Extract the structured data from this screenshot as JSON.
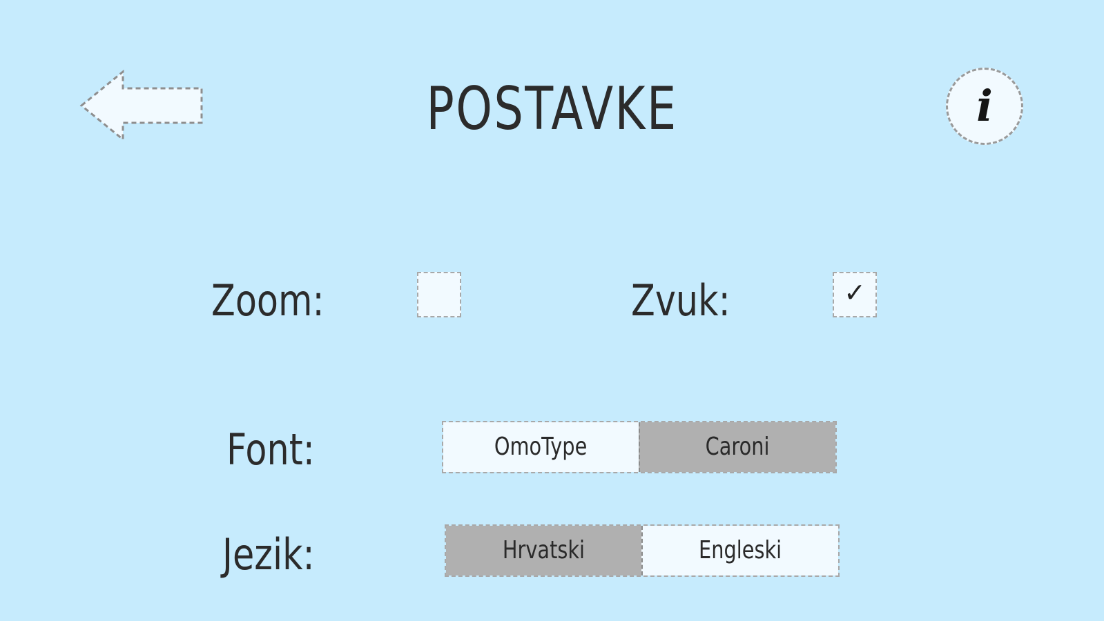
{
  "header": {
    "title": "POSTAVKE",
    "back_icon": "arrow-left-icon",
    "info_icon": "info-icon",
    "info_glyph": "i"
  },
  "settings": {
    "zoom": {
      "label": "Zoom:",
      "checked": false
    },
    "sound": {
      "label": "Zvuk:",
      "checked": true,
      "check_glyph": "✓"
    },
    "font": {
      "label": "Font:",
      "options": [
        "OmoType",
        "Caroni"
      ],
      "selected": "Caroni"
    },
    "language": {
      "label": "Jezik:",
      "options": [
        "Hrvatski",
        "Engleski"
      ],
      "selected": "Hrvatski"
    }
  },
  "colors": {
    "background": "#c6ebfd",
    "control_fill": "#f2faff",
    "selected_fill": "#b0b0b0",
    "text": "#2b2b2b"
  }
}
